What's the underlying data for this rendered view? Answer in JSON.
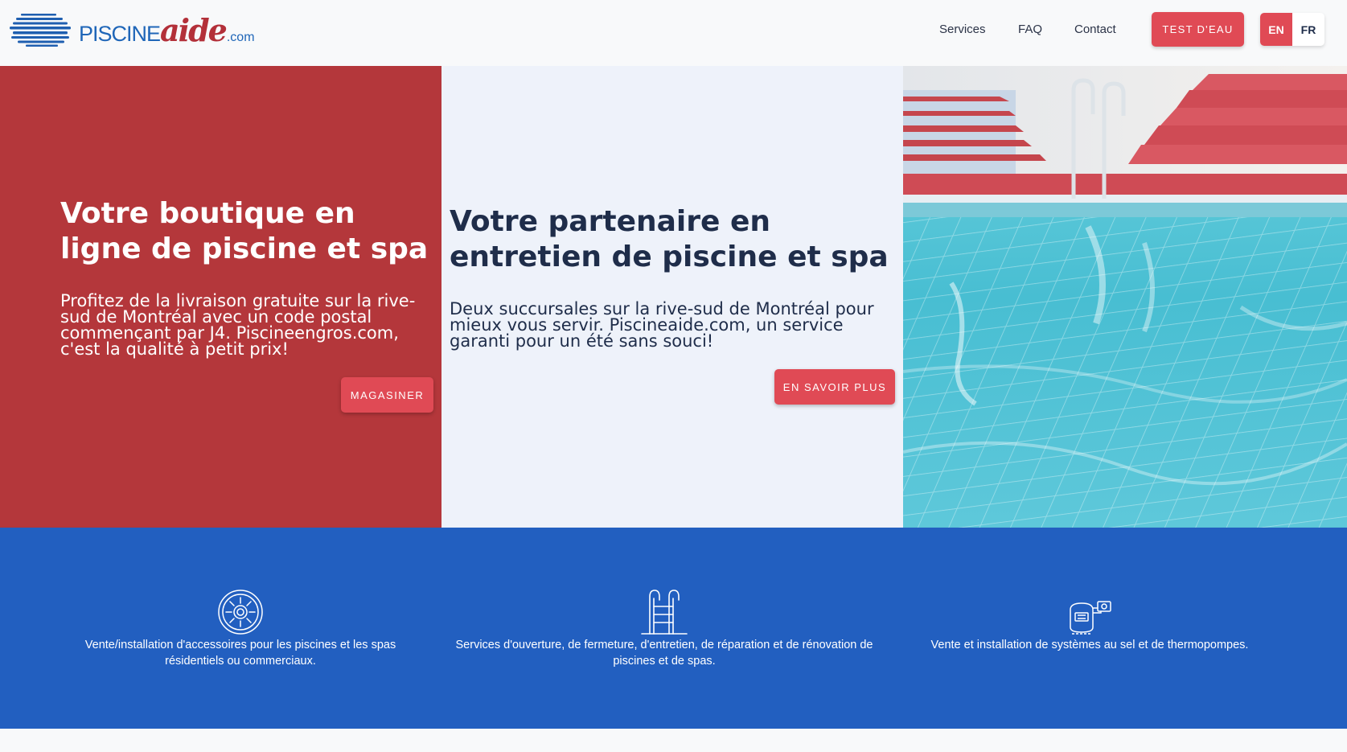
{
  "brand": {
    "piscine": "PISCINE",
    "aide": "aide",
    "com": ".com"
  },
  "nav": {
    "services": "Services",
    "faq": "FAQ",
    "contact": "Contact",
    "test_button": "TEST D'EAU",
    "lang_en": "EN",
    "lang_fr": "FR"
  },
  "hero": {
    "left": {
      "title": "Votre boutique en ligne de piscine et spa",
      "text": "Profitez de la livraison gratuite sur la rive-sud de Montréal avec un code postal commençant par J4. Piscineengros.com, c'est la qualité à petit prix!",
      "button": "MAGASINER"
    },
    "middle": {
      "title": "Votre partenaire en entretien de piscine et spa",
      "text": "Deux succursales sur la rive-sud de Montréal pour mieux vous servir. Piscineaide.com, un service garanti pour un été sans souci!",
      "button": "EN SAVOIR PLUS"
    }
  },
  "services": [
    {
      "icon": "pool-drain-icon",
      "text": "Vente/installation d'accessoires pour les piscines et les spas résidentiels ou commerciaux."
    },
    {
      "icon": "pool-ladder-icon",
      "text": "Services d'ouverture, de fermeture, d'entretien, de réparation et de rénovation de piscines et de spas."
    },
    {
      "icon": "pool-filter-icon",
      "text": "Vente et installation de systèmes au sel et de thermopompes."
    }
  ],
  "colors": {
    "red": "#b4373b",
    "accent": "#e04a55",
    "blue": "#225fc0",
    "navy": "#1f2d4a"
  }
}
